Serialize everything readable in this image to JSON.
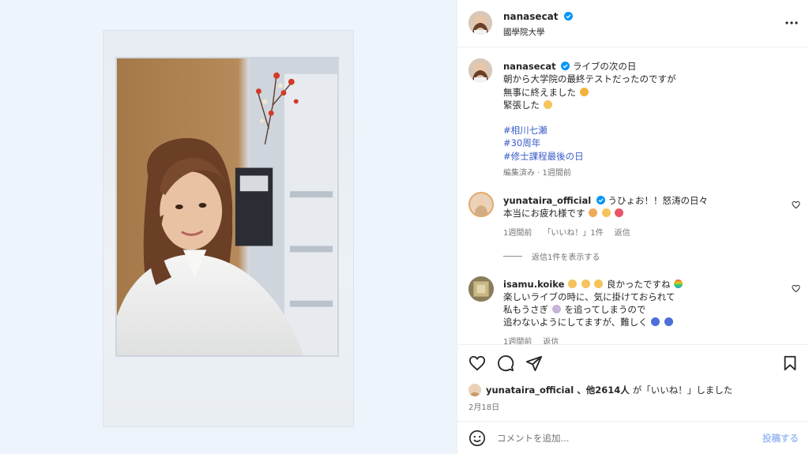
{
  "header": {
    "username": "nanasecat",
    "location": "國學院大學",
    "more_icon": "more-horizontal-icon"
  },
  "caption": {
    "username": "nanasecat",
    "lines": [
      "ライブの次の日",
      "朝から大学院の最終テストだったのですが",
      "無事に終えました",
      "緊張した"
    ],
    "hashtags": [
      "#相川七瀬",
      "#30周年",
      "#修士課程最後の日"
    ],
    "meta": "編集済み · 1週間前"
  },
  "comments": [
    {
      "username": "yunataira_official",
      "lines": [
        "うひょお！！怒涛の日々",
        "本当にお疲れ様です"
      ],
      "time": "1週間前",
      "likes": "「いいね！」1件",
      "reply": "返信",
      "view_replies": "返信1件を表示する"
    },
    {
      "username": "isamu.koike",
      "lines": [
        "良かったですね",
        "楽しいライブの時に、気に掛けておられて",
        "私もうさぎ",
        "を追ってしまうので",
        "追わないようにしてますが、難しく"
      ],
      "time": "1週間前",
      "reply": "返信"
    }
  ],
  "actions": {
    "like_icon": "heart-icon",
    "comment_icon": "comment-icon",
    "share_icon": "share-icon",
    "save_icon": "bookmark-icon"
  },
  "likes": {
    "user": "yunataira_official",
    "others": "、他2614人",
    "suffix": "が「いいね！」しました"
  },
  "date": "2月18日",
  "comment_box": {
    "placeholder": "コメントを追加...",
    "post_label": "投稿する"
  },
  "colors": {
    "hashtag": "#3a5dc8",
    "verified": "#0095f6",
    "post_button": "#9ebdf2",
    "media_background": "#eef4fb"
  }
}
